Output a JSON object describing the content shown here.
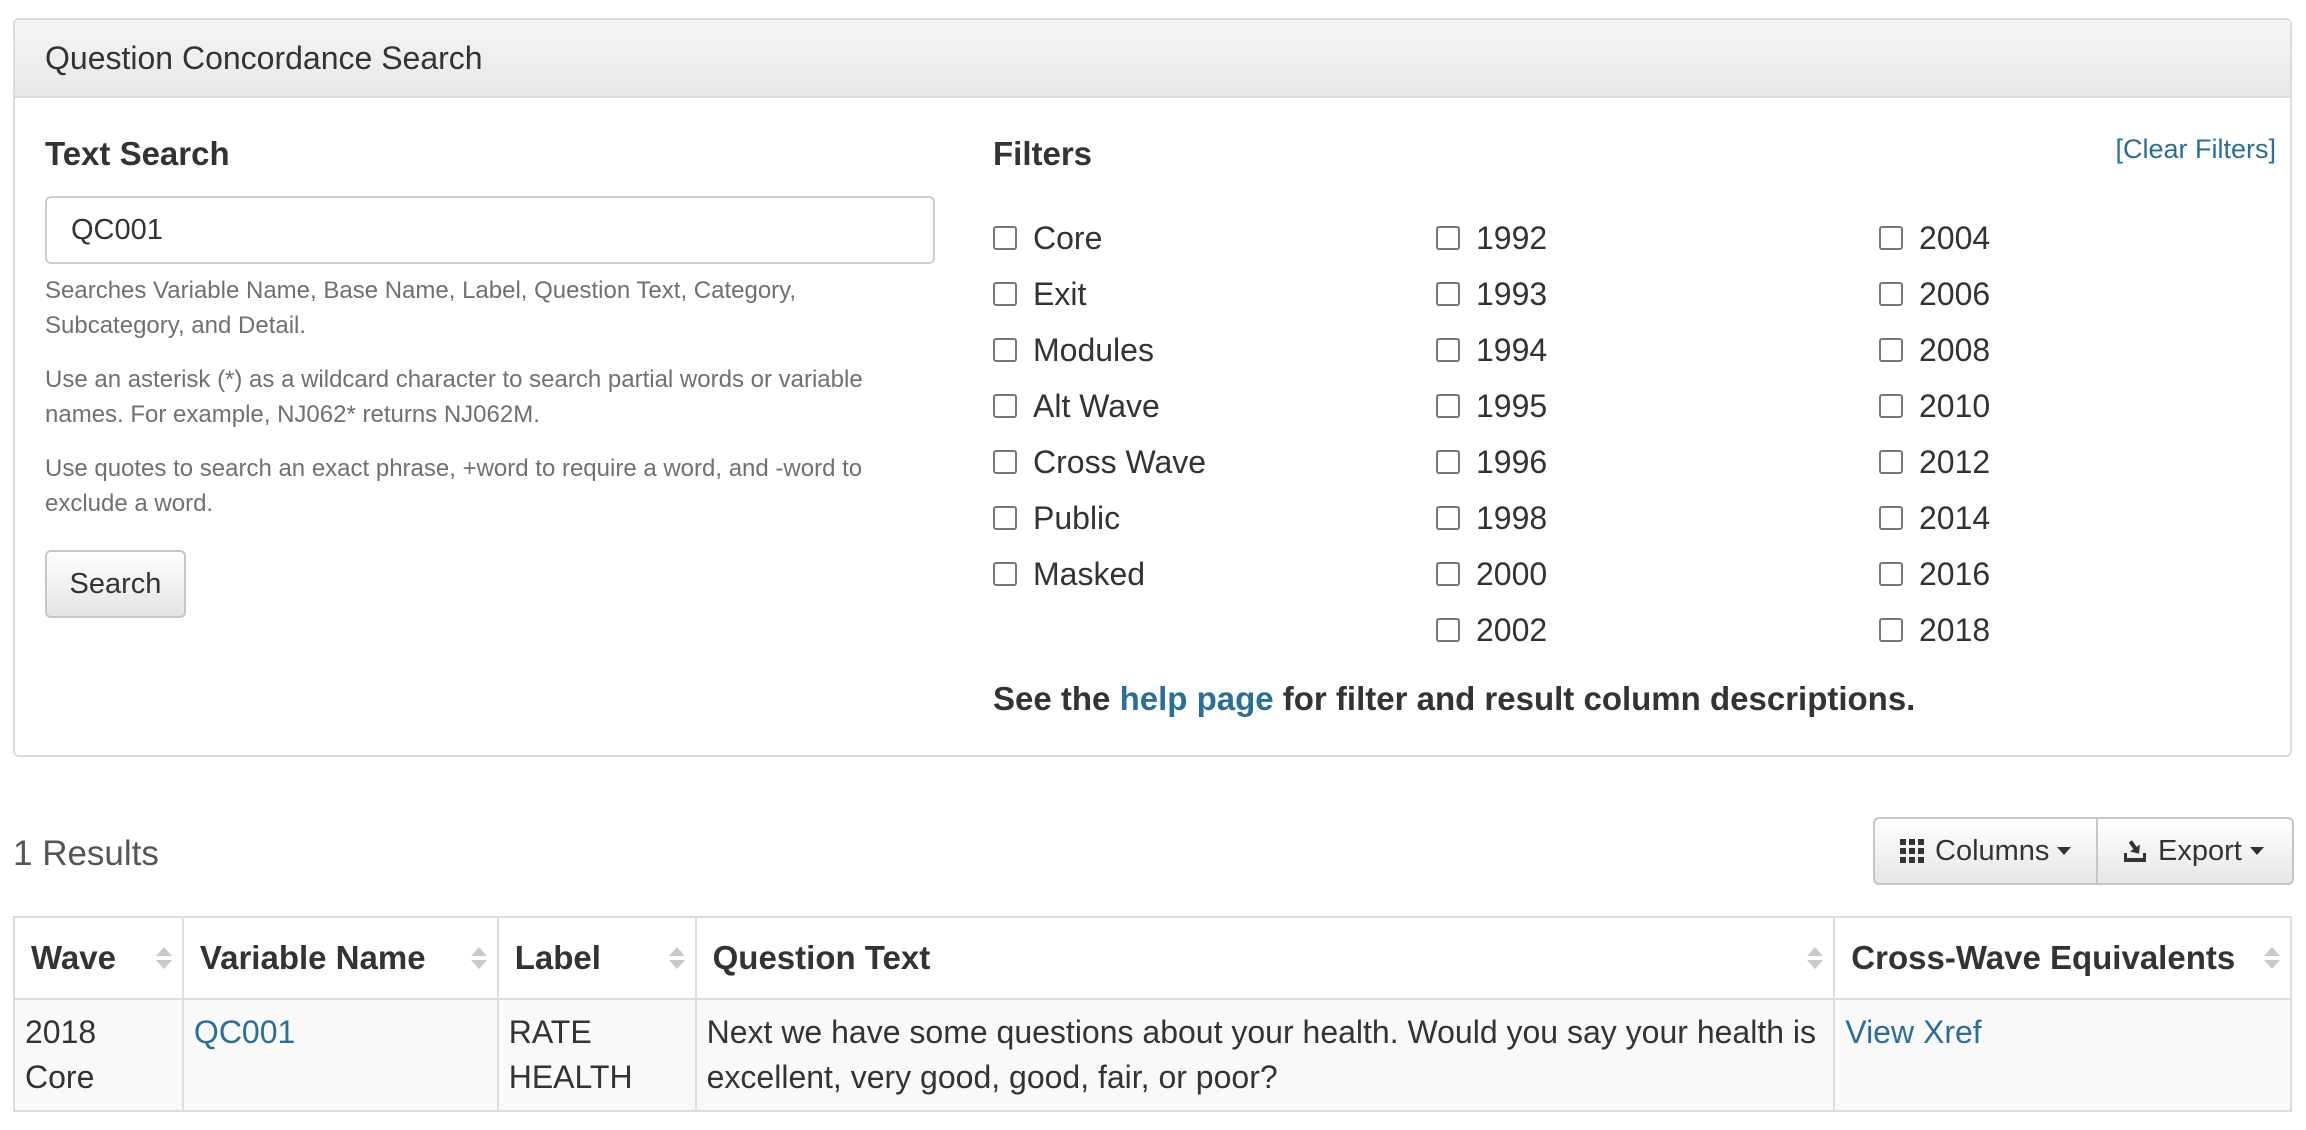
{
  "panel": {
    "title": "Question Concordance Search"
  },
  "text_search": {
    "title": "Text Search",
    "value": "QC001",
    "help": [
      "Searches Variable Name, Base Name, Label, Question Text, Category, Subcategory, and Detail.",
      "Use an asterisk (*) as a wildcard character to search partial words or variable names. For example, NJ062* returns NJ062M.",
      "Use quotes to search an exact phrase, +word to require a word, and -word to exclude a word."
    ],
    "search_button": "Search"
  },
  "filters": {
    "title": "Filters",
    "clear_label": "[Clear Filters]",
    "col1": [
      "Core",
      "Exit",
      "Modules",
      "Alt Wave",
      "Cross Wave",
      "Public",
      "Masked"
    ],
    "col2": [
      "1992",
      "1993",
      "1994",
      "1995",
      "1996",
      "1998",
      "2000",
      "2002"
    ],
    "col3": [
      "2004",
      "2006",
      "2008",
      "2010",
      "2012",
      "2014",
      "2016",
      "2018"
    ],
    "help_note": {
      "before": "See the ",
      "link": "help page",
      "after": " for filter and result column descriptions."
    }
  },
  "results": {
    "count_label": "1 Results",
    "columns_button": "Columns",
    "export_button": "Export",
    "headers": [
      "Wave",
      "Variable Name",
      "Label",
      "Question Text",
      "Cross-Wave Equivalents"
    ],
    "rows": [
      {
        "wave": "2018 Core",
        "variable_name": "QC001",
        "label": "RATE HEALTH",
        "question_text": "Next we have some questions about your health. Would you say your health is excellent, very good, good, fair, or poor?",
        "xref": "View Xref"
      }
    ]
  },
  "colors": {
    "link": "#2a6f97",
    "text": "#333333",
    "muted": "#707070"
  }
}
